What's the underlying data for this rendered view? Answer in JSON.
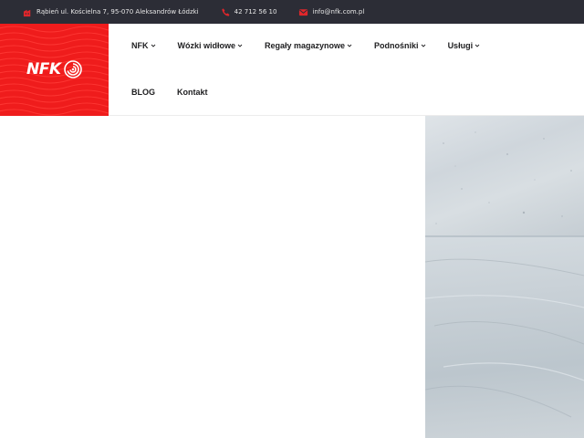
{
  "topbar": {
    "address": "Rąbień ul. Kościelna 7, 95-070 Aleksandrów Łódzki",
    "phone": "42 712 56 10",
    "email": "info@nfk.com.pl"
  },
  "logo": {
    "text": "NFK"
  },
  "nav": {
    "row1": [
      {
        "label": "NFK",
        "dropdown": true
      },
      {
        "label": "Wózki widłowe",
        "dropdown": true
      },
      {
        "label": "Regały magazynowe",
        "dropdown": true
      },
      {
        "label": "Podnośniki",
        "dropdown": true
      },
      {
        "label": "Usługi",
        "dropdown": true
      }
    ],
    "row2": [
      {
        "label": "BLOG",
        "dropdown": false
      },
      {
        "label": "Kontakt",
        "dropdown": false
      }
    ]
  },
  "colors": {
    "brand_red": "#ef1c1c",
    "topbar_bg": "#2c2d36",
    "icon_red": "#e0262b"
  },
  "icons": {
    "address": "building-icon",
    "phone": "phone-icon",
    "email": "envelope-icon"
  }
}
